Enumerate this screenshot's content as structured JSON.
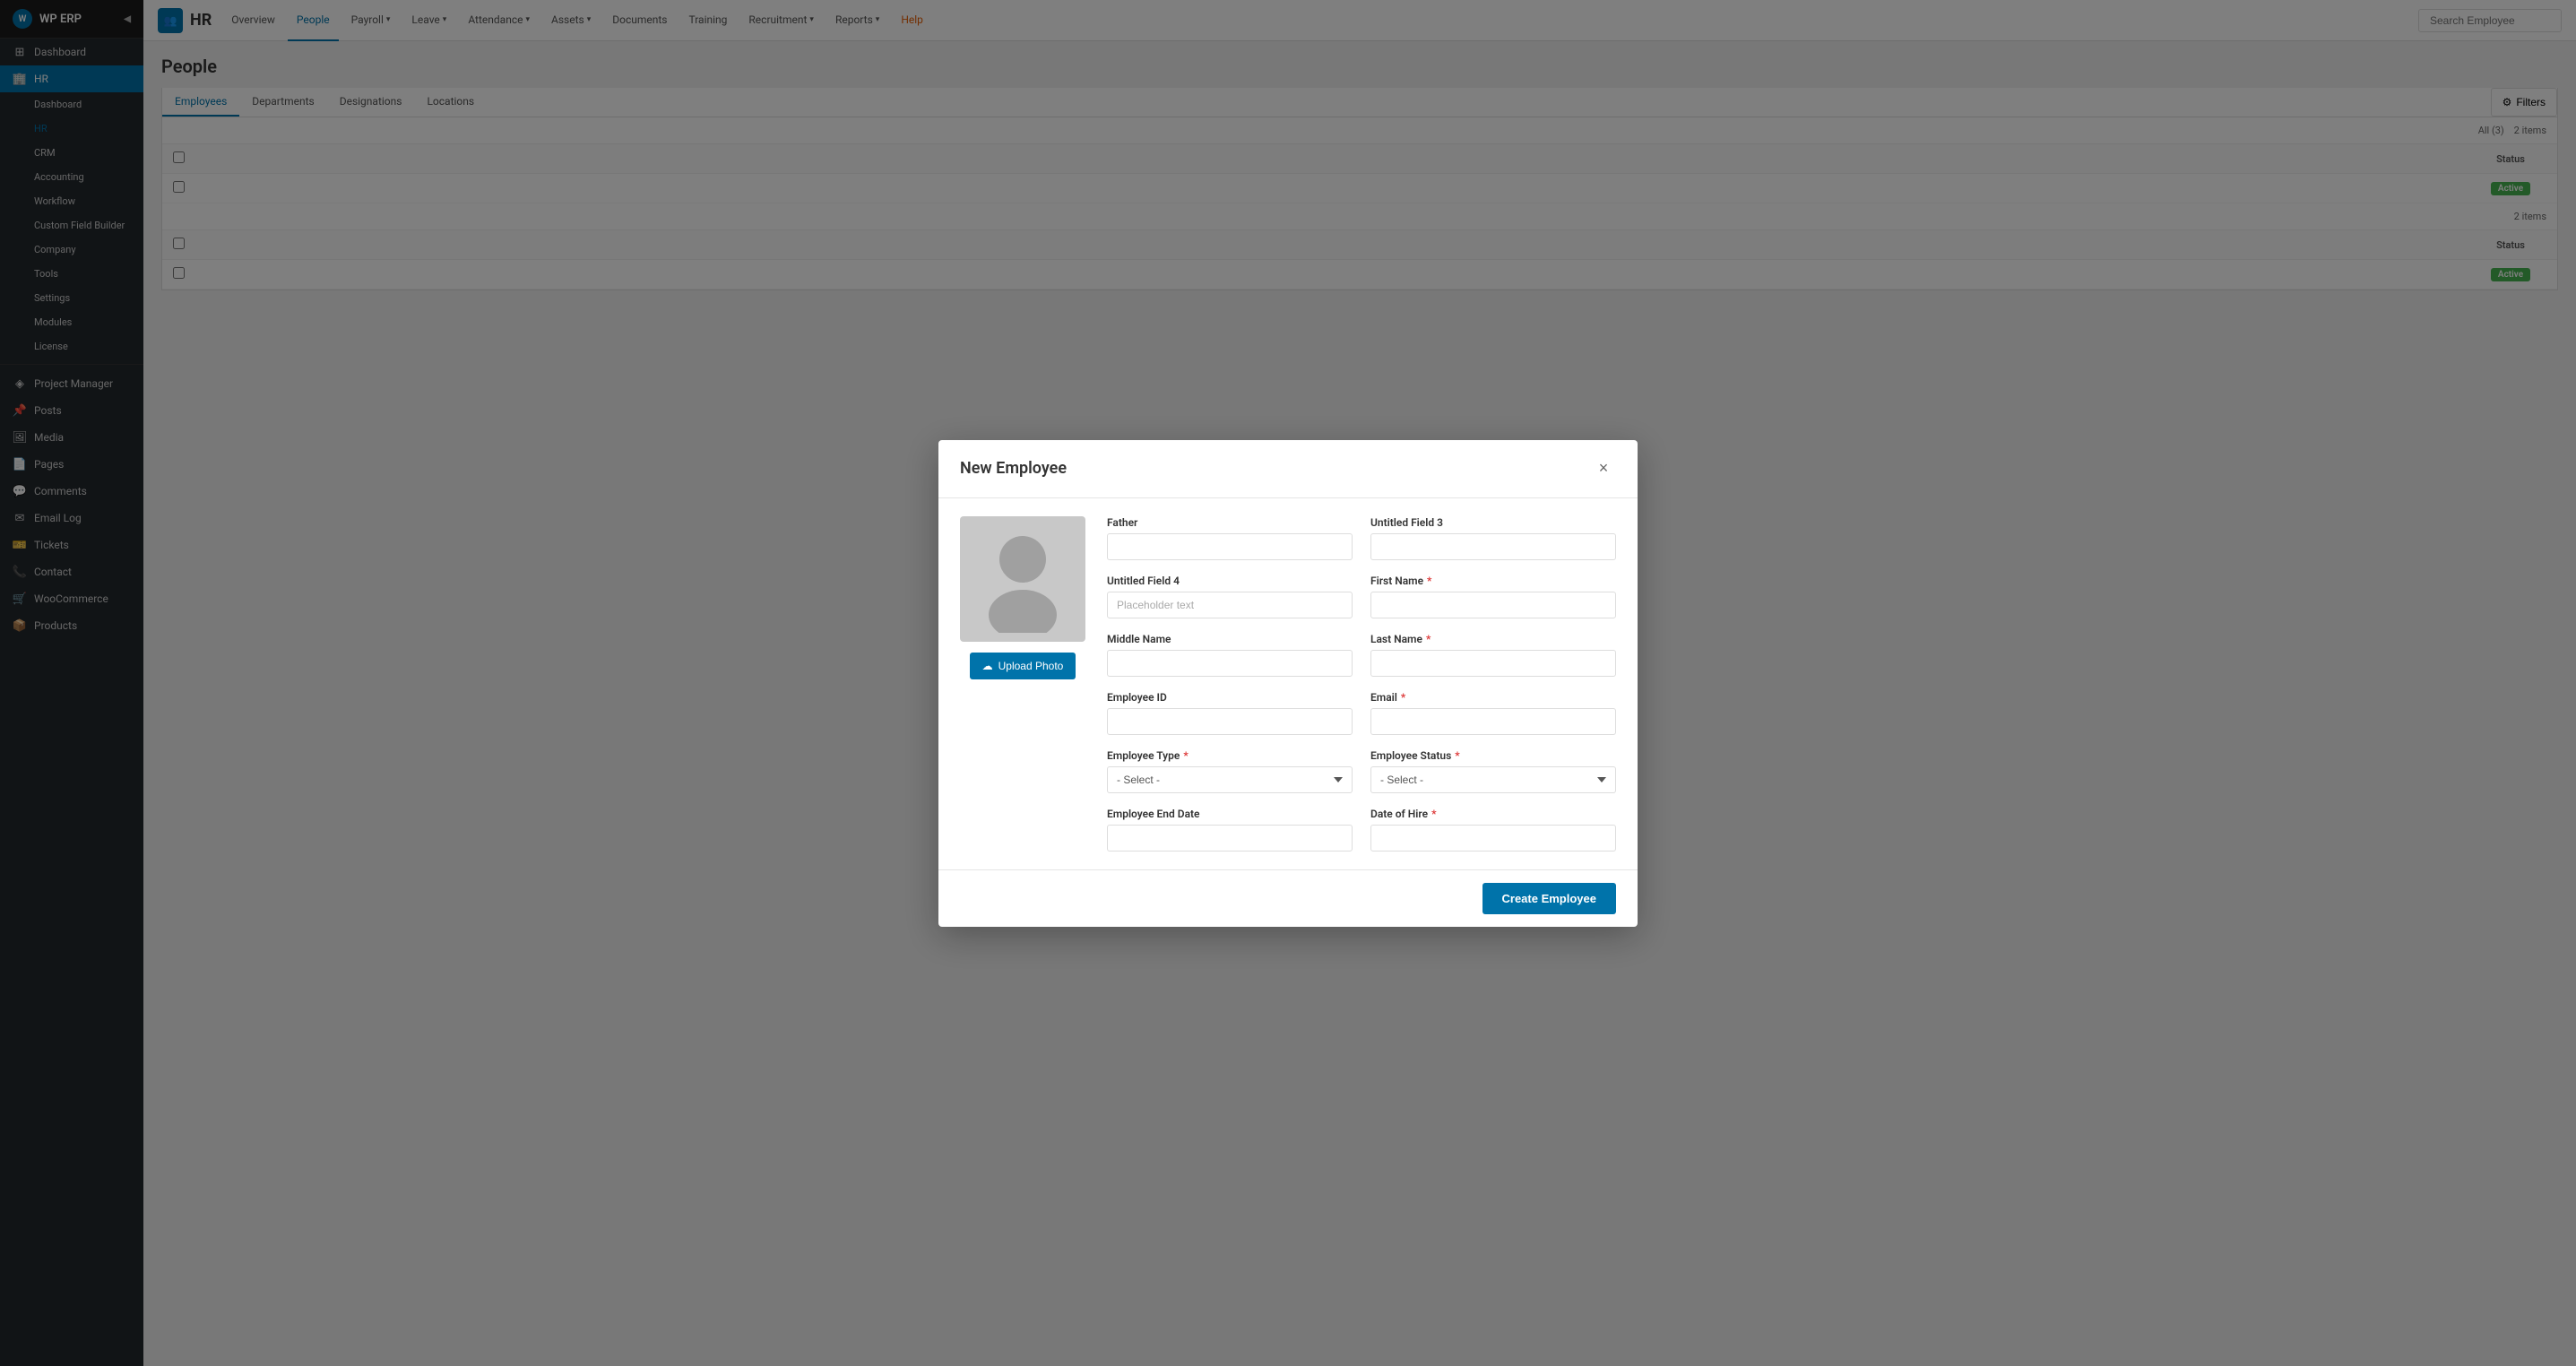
{
  "sidebar": {
    "brand": "WP ERP",
    "top_items": [
      {
        "label": "Dashboard",
        "icon": "⊞"
      },
      {
        "label": "WP ERP",
        "icon": "●",
        "active": true
      },
      {
        "label": "Dashboard",
        "icon": ""
      },
      {
        "label": "HR",
        "icon": "",
        "active": true
      },
      {
        "label": "CRM",
        "icon": ""
      },
      {
        "label": "Accounting",
        "icon": ""
      },
      {
        "label": "Workflow",
        "icon": ""
      },
      {
        "label": "Custom Field Builder",
        "icon": ""
      },
      {
        "label": "Company",
        "icon": ""
      },
      {
        "label": "Tools",
        "icon": ""
      },
      {
        "label": "Settings",
        "icon": ""
      },
      {
        "label": "Modules",
        "icon": ""
      },
      {
        "label": "License",
        "icon": ""
      }
    ],
    "bottom_items": [
      {
        "label": "Project Manager",
        "icon": "◈"
      },
      {
        "label": "Posts",
        "icon": "📌"
      },
      {
        "label": "Media",
        "icon": "🖼"
      },
      {
        "label": "Pages",
        "icon": "📄"
      },
      {
        "label": "Comments",
        "icon": "💬"
      },
      {
        "label": "Email Log",
        "icon": "✉"
      },
      {
        "label": "Tickets",
        "icon": "🎫"
      },
      {
        "label": "Contact",
        "icon": "📞"
      },
      {
        "label": "WooCommerce",
        "icon": "🛒"
      },
      {
        "label": "Products",
        "icon": "📦"
      }
    ]
  },
  "top_nav": {
    "brand_icon": "👥",
    "brand_title": "HR",
    "items": [
      {
        "label": "Overview",
        "active": false
      },
      {
        "label": "People",
        "active": true
      },
      {
        "label": "Payroll",
        "has_arrow": true
      },
      {
        "label": "Leave",
        "has_arrow": true
      },
      {
        "label": "Attendance",
        "has_arrow": true
      },
      {
        "label": "Assets",
        "has_arrow": true
      },
      {
        "label": "Documents"
      },
      {
        "label": "Training"
      },
      {
        "label": "Recruitment",
        "has_arrow": true
      },
      {
        "label": "Reports",
        "has_arrow": true
      },
      {
        "label": "Help",
        "special": "help"
      }
    ],
    "search_placeholder": "Search Employee"
  },
  "page": {
    "title": "People",
    "tabs": [
      {
        "label": "Employees",
        "active": true
      },
      {
        "label": "Departments"
      },
      {
        "label": "Designations"
      },
      {
        "label": "Locations"
      }
    ],
    "filter_label": "Filters",
    "all_label": "All (3)",
    "table_info_1": "2 items",
    "table_info_2": "2 items",
    "status_header": "Status",
    "status_badge": "Active"
  },
  "modal": {
    "title": "New Employee",
    "close_label": "×",
    "avatar_alt": "avatar placeholder",
    "upload_btn_label": "Upload Photo",
    "fields": {
      "father": {
        "label": "Father",
        "placeholder": "",
        "required": false
      },
      "untitled_field_3": {
        "label": "Untitled Field 3",
        "placeholder": "",
        "required": false
      },
      "untitled_field_4": {
        "label": "Untitled Field 4",
        "placeholder": "Placeholder text",
        "required": false
      },
      "first_name": {
        "label": "First Name",
        "placeholder": "",
        "required": true
      },
      "middle_name": {
        "label": "Middle Name",
        "placeholder": "",
        "required": false
      },
      "last_name": {
        "label": "Last Name",
        "placeholder": "",
        "required": true
      },
      "employee_id": {
        "label": "Employee ID",
        "placeholder": "",
        "required": false
      },
      "email": {
        "label": "Email",
        "placeholder": "",
        "required": true
      },
      "employee_type": {
        "label": "Employee Type",
        "placeholder": "- Select -",
        "required": true
      },
      "employee_status": {
        "label": "Employee Status",
        "placeholder": "- Select -",
        "required": true
      },
      "employee_end_date": {
        "label": "Employee End Date",
        "placeholder": "",
        "required": false
      },
      "date_of_hire": {
        "label": "Date of Hire",
        "placeholder": "",
        "required": true
      }
    },
    "create_btn_label": "Create Employee"
  }
}
